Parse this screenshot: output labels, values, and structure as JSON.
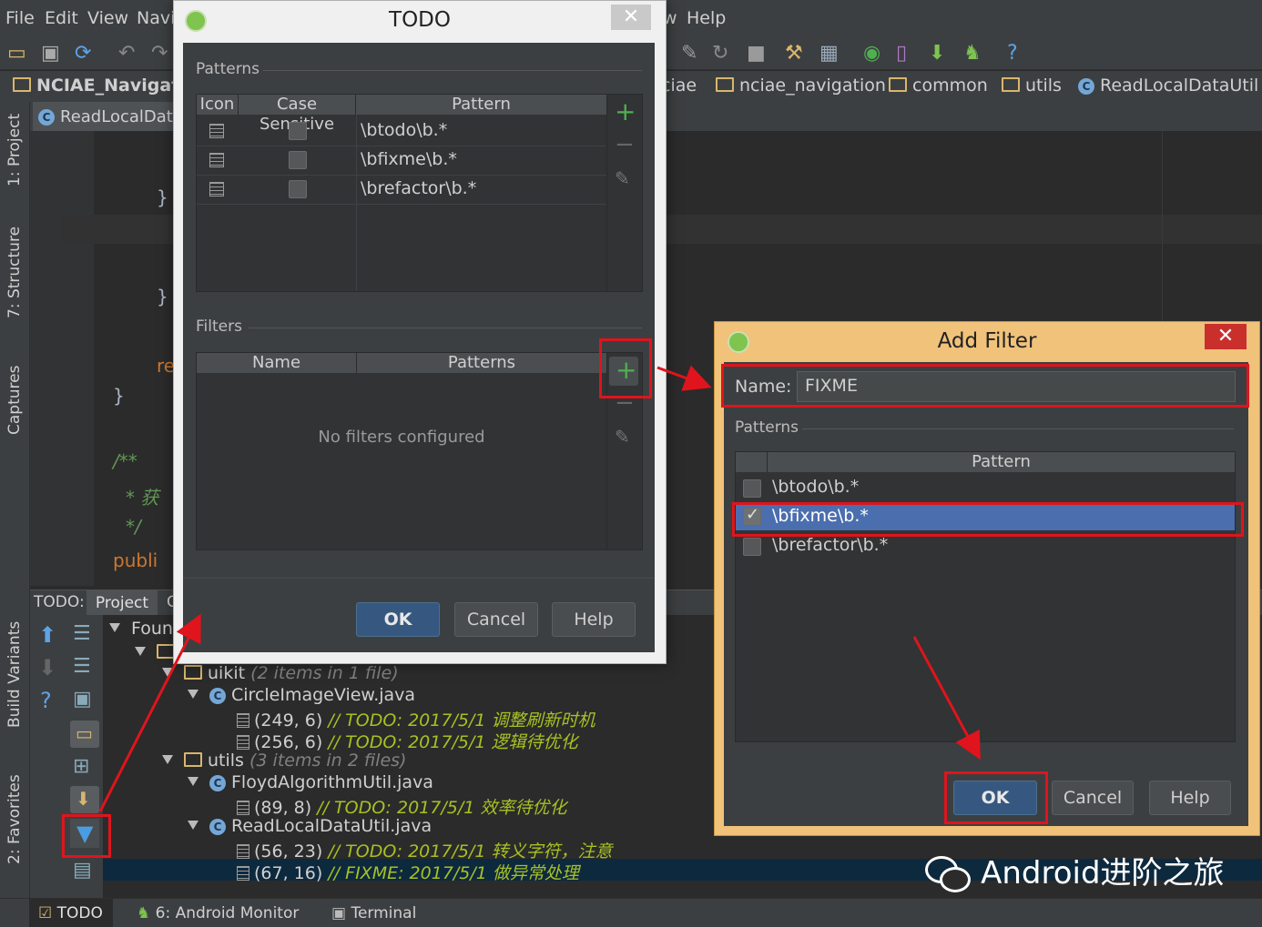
{
  "menu": [
    "File",
    "Edit",
    "View",
    "Navi",
    "w",
    "Help"
  ],
  "project_name": "NCIAE_Navigatic",
  "breadcrumbs": [
    "ciae",
    "nciae_navigation",
    "common",
    "utils",
    "ReadLocalDataUtil"
  ],
  "editor_tab": "ReadLocalDat",
  "left_tabs": [
    "1: Project",
    "7: Structure",
    "Captures",
    "Build Variants",
    "2: Favorites"
  ],
  "code_lines": [
    "}",
    "}",
    "re",
    "}",
    "/**",
    "* 获",
    "*/",
    "publi"
  ],
  "todo_panel": {
    "label": "TODO:",
    "tab_project": "Project",
    "tab_more": "C",
    "tree": [
      {
        "text": "Foun",
        "note": ""
      },
      {
        "text": "",
        "note": ""
      },
      {
        "text": "uikit",
        "note": "(2 items in 1 file)"
      },
      {
        "text": "CircleImageView.java",
        "note": ""
      },
      {
        "text": "(249, 6)",
        "note": "// TODO: 2017/5/1 调整刷新时机"
      },
      {
        "text": "(256, 6)",
        "note": "// TODO: 2017/5/1 逻辑待优化"
      },
      {
        "text": "utils",
        "note": "(3 items in 2 files)"
      },
      {
        "text": "FloydAlgorithmUtil.java",
        "note": ""
      },
      {
        "text": "(89, 8)",
        "note": "// TODO: 2017/5/1 效率待优化"
      },
      {
        "text": "ReadLocalDataUtil.java",
        "note": ""
      },
      {
        "text": "(56, 23)",
        "note": "// TODO: 2017/5/1 转义字符，注意"
      },
      {
        "text": "(67, 16)",
        "note": "// FIXME: 2017/5/1 做异常处理"
      }
    ]
  },
  "status_tabs": [
    "TODO",
    "6: Android Monitor",
    "Terminal"
  ],
  "todo_dialog": {
    "title": "TODO",
    "close": "✕",
    "patterns_label": "Patterns",
    "col_icon": "Icon",
    "col_case": "Case Sensitive",
    "col_pattern": "Pattern",
    "patterns": [
      "\\btodo\\b.*",
      "\\bfixme\\b.*",
      "\\brefactor\\b.*"
    ],
    "filters_label": "Filters",
    "col_name": "Name",
    "col_patterns": "Patterns",
    "empty": "No filters configured",
    "ok": "OK",
    "cancel": "Cancel",
    "help": "Help"
  },
  "add_filter": {
    "title": "Add Filter",
    "close": "✕",
    "name_label": "Name:",
    "name_value": "FIXME",
    "patterns_label": "Patterns",
    "col_pattern": "Pattern",
    "patterns": [
      {
        "text": "\\btodo\\b.*",
        "checked": false
      },
      {
        "text": "\\bfixme\\b.*",
        "checked": true
      },
      {
        "text": "\\brefactor\\b.*",
        "checked": false
      }
    ],
    "ok": "OK",
    "cancel": "Cancel",
    "help": "Help"
  },
  "watermark": "Android进阶之旅",
  "colors": {
    "accent_red": "#e0141c",
    "selection": "#4b6eaf",
    "todo": "#a8c023",
    "dialog_frame": "#f0c27a"
  }
}
